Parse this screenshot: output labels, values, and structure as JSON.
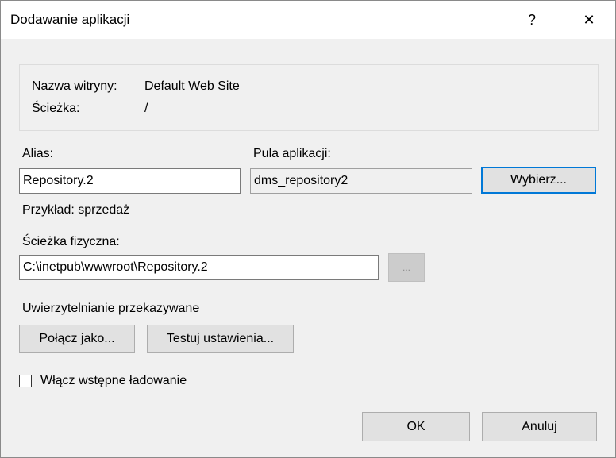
{
  "window": {
    "title": "Dodawanie aplikacji",
    "help_glyph": "?",
    "close_glyph": "✕"
  },
  "site_info": {
    "site_name_label": "Nazwa witryny:",
    "site_name_value": "Default Web Site",
    "path_label": "Ścieżka:",
    "path_value": "/"
  },
  "alias": {
    "label": "Alias:",
    "value": "Repository.2",
    "example": "Przykład: sprzedaż"
  },
  "app_pool": {
    "label": "Pula aplikacji:",
    "value": "dms_repository2",
    "select_button": "Wybierz..."
  },
  "physical_path": {
    "label": "Ścieżka fizyczna:",
    "value": "C:\\inetpub\\wwwroot\\Repository.2",
    "browse_button": "..."
  },
  "pass_through_auth": {
    "label": "Uwierzytelnianie przekazywane",
    "connect_as_button": "Połącz jako...",
    "test_settings_button": "Testuj ustawienia..."
  },
  "preload": {
    "label": "Włącz wstępne ładowanie",
    "checked": false
  },
  "footer": {
    "ok_button": "OK",
    "cancel_button": "Anuluj"
  }
}
